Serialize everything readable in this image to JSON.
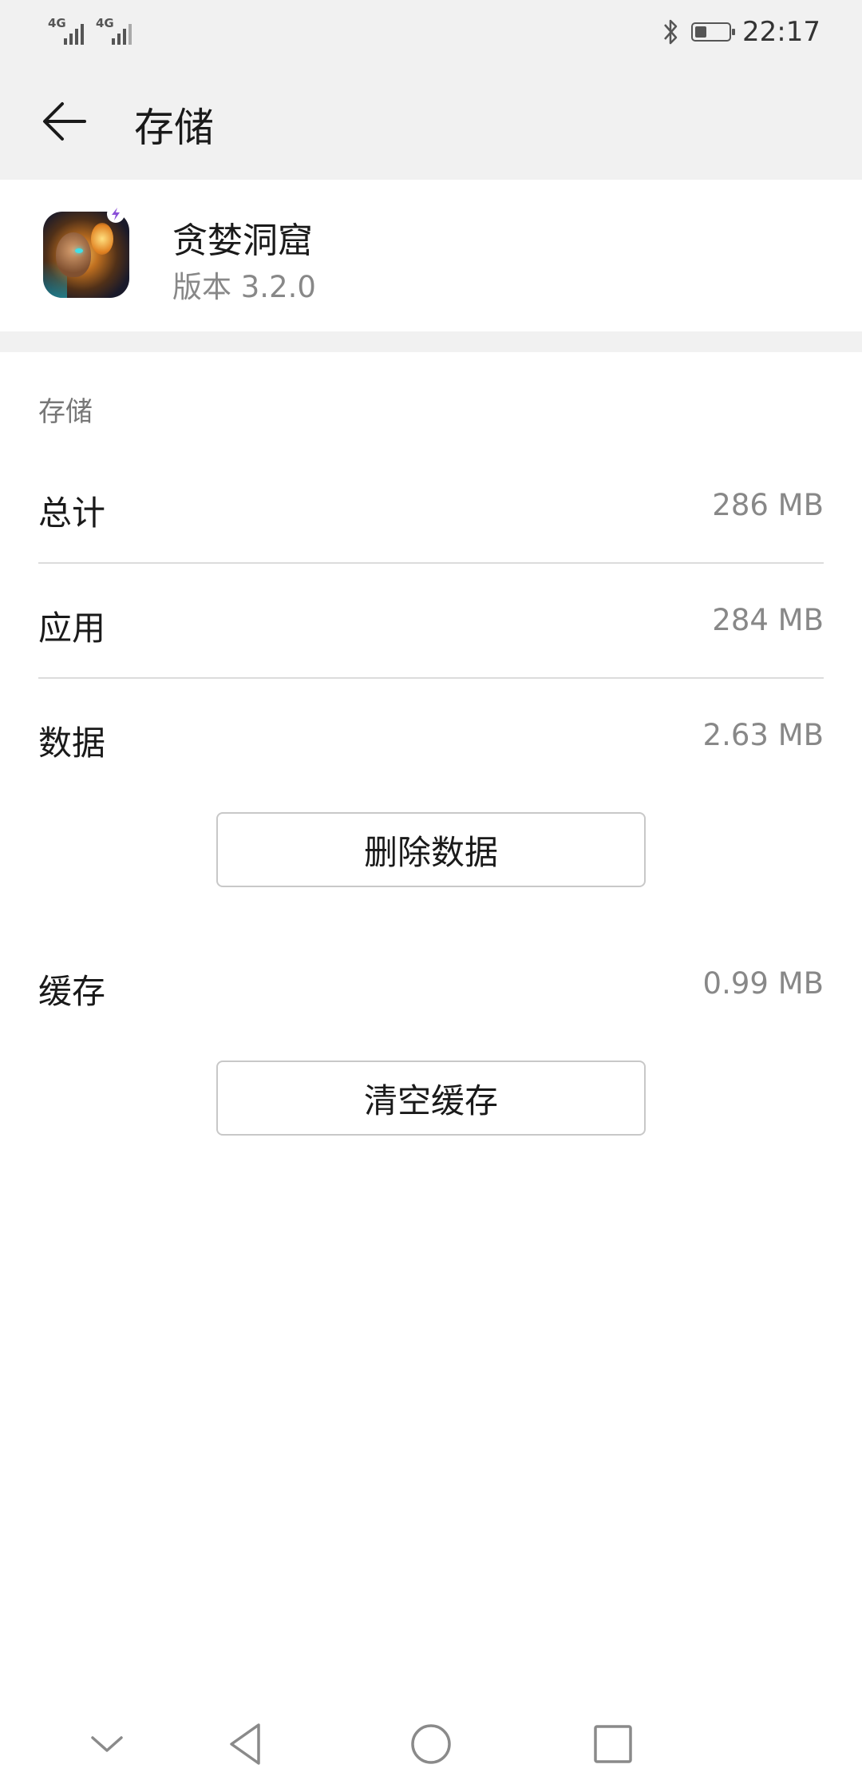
{
  "status_bar": {
    "network_1": "4G",
    "network_2": "4G",
    "time": "22:17",
    "icons": [
      "signal-icon",
      "signal-icon",
      "bluetooth-icon",
      "battery-icon"
    ]
  },
  "header": {
    "title": "存储",
    "back_icon": "arrow-left-icon"
  },
  "app": {
    "name": "贪婪洞窟",
    "version": "版本 3.2.0"
  },
  "storage": {
    "section_title": "存储",
    "total_label": "总计",
    "total_value": "286 MB",
    "app_label": "应用",
    "app_value": "284 MB",
    "data_label": "数据",
    "data_value": "2.63 MB",
    "delete_data_button": "删除数据",
    "cache_label": "缓存",
    "cache_value": "0.99 MB",
    "clear_cache_button": "清空缓存"
  },
  "nav_bar": {
    "icons": [
      "chevron-down-icon",
      "back-triangle-icon",
      "home-circle-icon",
      "recents-square-icon"
    ]
  },
  "colors": {
    "header_bg": "#f1f1f1",
    "text_primary": "#1a1a1a",
    "text_secondary": "#888888",
    "button_border": "#c8c8c8"
  }
}
